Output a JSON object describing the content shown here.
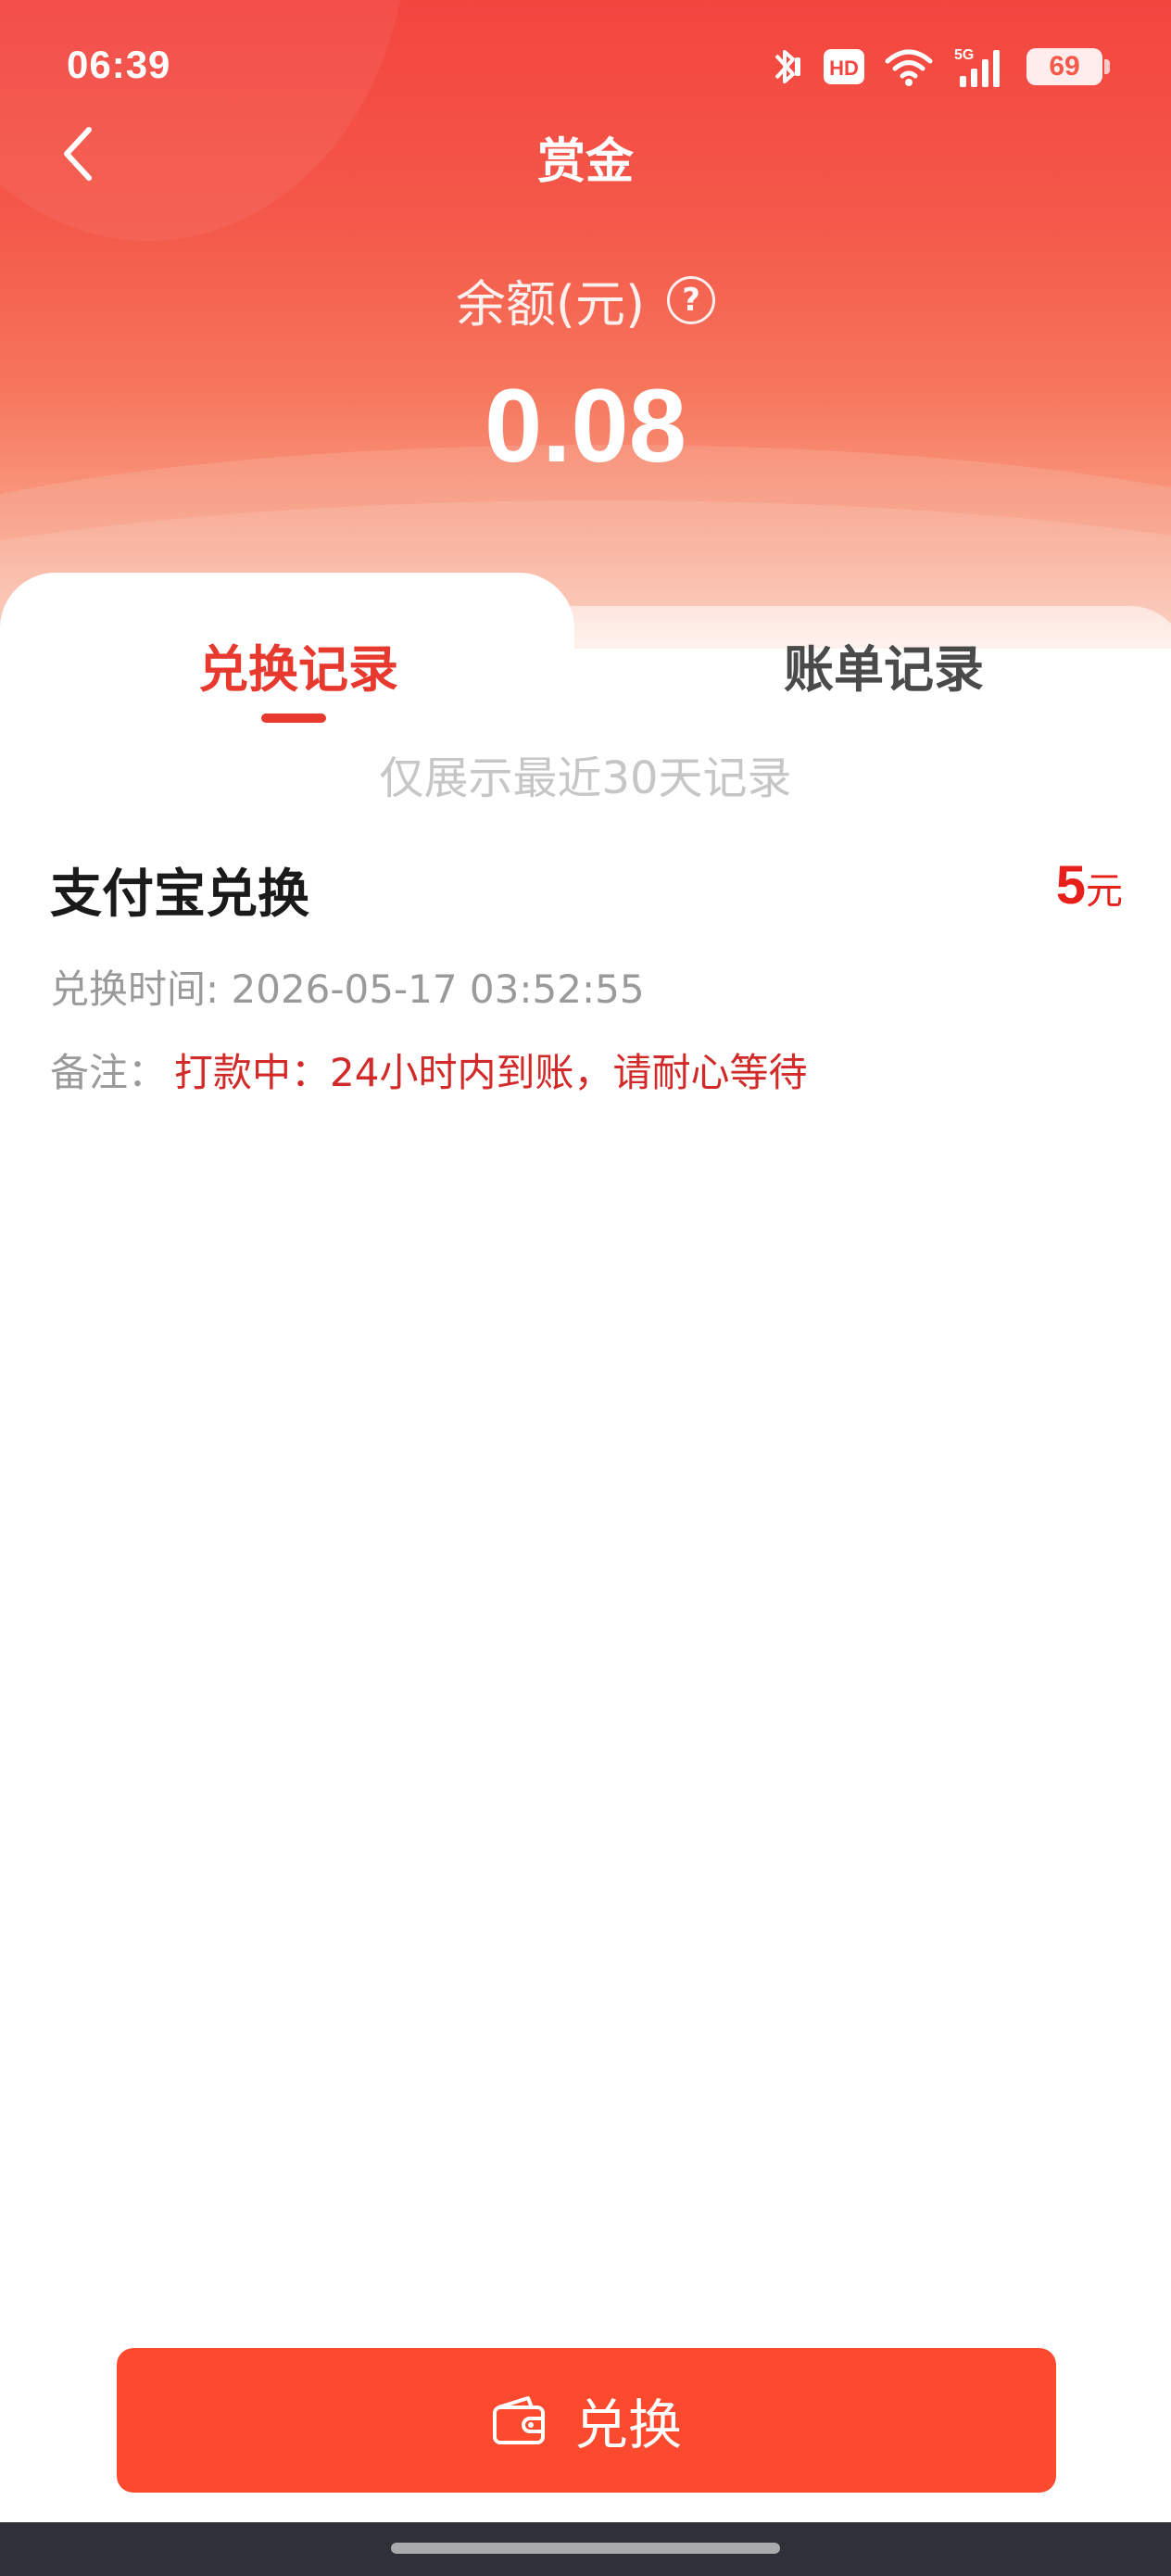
{
  "status_bar": {
    "time": "06:39",
    "battery": "69",
    "icons": [
      "bluetooth-icon",
      "hd-icon",
      "wifi-icon",
      "5g-signal-icon",
      "battery-icon"
    ]
  },
  "header": {
    "title": "赏金",
    "back_icon": "chevron-left-icon"
  },
  "balance": {
    "label": "余额(元)",
    "value": "0.08",
    "help_glyph": "?"
  },
  "tabs": [
    {
      "label": "兑换记录",
      "active": true
    },
    {
      "label": "账单记录",
      "active": false
    }
  ],
  "hint": "仅展示最近30天记录",
  "records": [
    {
      "title": "支付宝兑换",
      "amount": "5",
      "unit": "元",
      "time_label": "兑换时间: 2026-05-17 03:52:55",
      "note_label": "备注：",
      "note_text": "打款中：24小时内到账，请耐心等待"
    }
  ],
  "action": {
    "label": "兑换",
    "icon": "wallet-icon"
  },
  "colors": {
    "primary_red": "#e8392f",
    "button_red": "#fb4a2d",
    "amount_red": "#e8201c"
  }
}
